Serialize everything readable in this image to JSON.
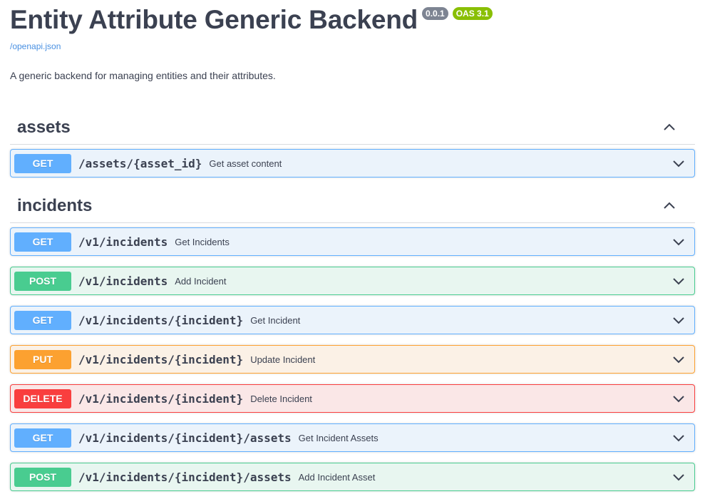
{
  "info": {
    "title": "Entity Attribute Generic Backend",
    "version_badge": "0.0.1",
    "oas_badge": "OAS 3.1",
    "spec_link": "/openapi.json",
    "description": "A generic backend for managing entities and their attributes."
  },
  "tags": [
    {
      "name": "assets",
      "operations": [
        {
          "method": "GET",
          "path": "/assets/{asset_id}",
          "summary": "Get asset content"
        }
      ]
    },
    {
      "name": "incidents",
      "operations": [
        {
          "method": "GET",
          "path": "/v1/incidents",
          "summary": "Get Incidents"
        },
        {
          "method": "POST",
          "path": "/v1/incidents",
          "summary": "Add Incident"
        },
        {
          "method": "GET",
          "path": "/v1/incidents/{incident}",
          "summary": "Get Incident"
        },
        {
          "method": "PUT",
          "path": "/v1/incidents/{incident}",
          "summary": "Update Incident"
        },
        {
          "method": "DELETE",
          "path": "/v1/incidents/{incident}",
          "summary": "Delete Incident"
        },
        {
          "method": "GET",
          "path": "/v1/incidents/{incident}/assets",
          "summary": "Get Incident Assets"
        },
        {
          "method": "POST",
          "path": "/v1/incidents/{incident}/assets",
          "summary": "Add Incident Asset"
        }
      ]
    }
  ],
  "icons": {
    "tag_toggle": "chevron-up-icon",
    "op_toggle": "chevron-down-icon"
  },
  "colors": {
    "get": "#61affe",
    "post": "#49cc90",
    "put": "#fca130",
    "delete": "#f93e3e"
  }
}
